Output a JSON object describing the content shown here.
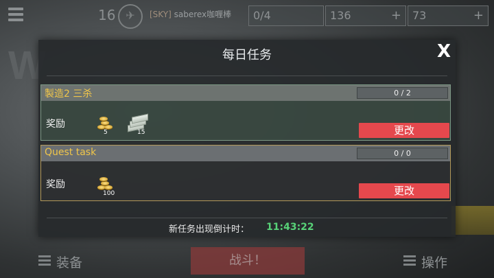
{
  "hud": {
    "level": "16",
    "clan_tag": "[SKY]",
    "player_name": "saberex咖喱棒",
    "resource1": "0/4",
    "resource2": "136",
    "resource3": "73",
    "background_letter": "W",
    "equip_label": "装备",
    "fight_label": "战斗！",
    "ops_label": "操作",
    "plus_symbol": "+"
  },
  "dialog": {
    "title": "每日任务",
    "close_symbol": "X",
    "quests": [
      {
        "name": "製造2 三杀",
        "progress": "0 / 2",
        "reward_label": "奖励",
        "rewards": [
          {
            "type": "gold",
            "icon": "gold-coins-icon",
            "count": "5"
          },
          {
            "type": "cash",
            "icon": "cash-icon",
            "count": "15"
          }
        ],
        "change_label": "更改"
      },
      {
        "name": "Quest task",
        "progress": "0 / 0",
        "reward_label": "奖励",
        "rewards": [
          {
            "type": "gold",
            "icon": "gold-coins-icon",
            "count": "100"
          }
        ],
        "change_label": "更改"
      }
    ],
    "timer_label": "新任务出现倒计时：",
    "timer_value": "11:43:22"
  },
  "colors": {
    "quest_name": "#f0c64a",
    "change_button": "#e5484d",
    "timer": "#58d278"
  }
}
